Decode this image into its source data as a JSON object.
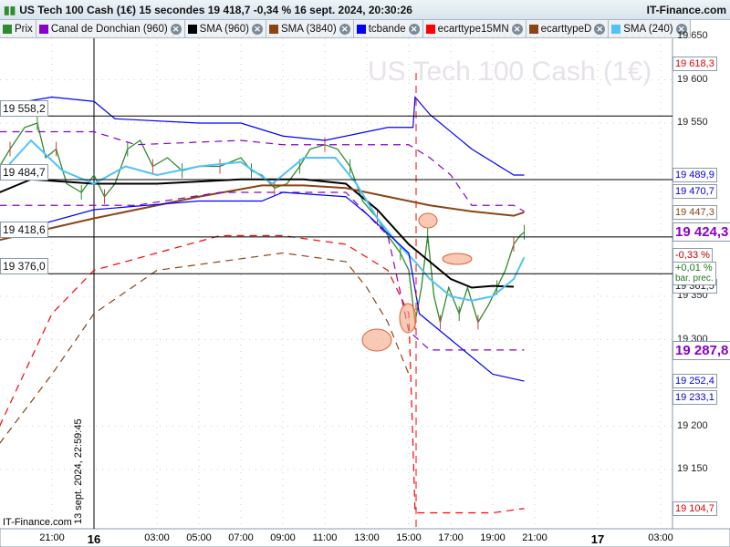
{
  "header": {
    "title": "US Tech 100 Cash (1€) 15 secondes 19 418,7 -0,34 % 16 sept. 2024, 20:30:26",
    "site": "IT-Finance.com"
  },
  "legend": [
    {
      "label": "Prix",
      "color": "#2e8b2e"
    },
    {
      "label": "Canal de Donchian (960)",
      "color": "#8a00c8"
    },
    {
      "label": "SMA (960)",
      "color": "#000000"
    },
    {
      "label": "SMA (3840)",
      "color": "#8b4513"
    },
    {
      "label": "tcbande",
      "color": "#0000ff"
    },
    {
      "label": "ecarttype15MN",
      "color": "#ff0000"
    },
    {
      "label": "ecarttypeD",
      "color": "#8b4513"
    },
    {
      "label": "SMA (240)",
      "color": "#4fc3f7"
    }
  ],
  "watermark": "US Tech 100 Cash (1€)",
  "footer": "IT-Finance.com",
  "vertical_date": "13 sept. 2024, 22:59:45",
  "chart_data": {
    "type": "line",
    "title": "US Tech 100 Cash (1€)",
    "ylim": [
      19090,
      19660
    ],
    "y_ticks": [
      "19 650",
      "19 600",
      "19 550",
      "19 350",
      "19 300",
      "19 200",
      "19 150"
    ],
    "y_tick_values": [
      19650,
      19600,
      19550,
      19350,
      19300,
      19200,
      19150
    ],
    "x_ticks": [
      {
        "label": "21:00",
        "h": -2
      },
      {
        "label": "16",
        "h": 0,
        "bold": true
      },
      {
        "label": "03:00",
        "h": 3
      },
      {
        "label": "05:00",
        "h": 5
      },
      {
        "label": "07:00",
        "h": 7
      },
      {
        "label": "09:00",
        "h": 9
      },
      {
        "label": "11:00",
        "h": 11
      },
      {
        "label": "13:00",
        "h": 13
      },
      {
        "label": "15:00",
        "h": 15
      },
      {
        "label": "17:00",
        "h": 17
      },
      {
        "label": "19:00",
        "h": 19
      },
      {
        "label": "21:00",
        "h": 21
      },
      {
        "label": "17",
        "h": 24,
        "bold": true
      },
      {
        "label": "03:00",
        "h": 27
      }
    ],
    "hlines": [
      {
        "label": "19 558,2",
        "value": 19558.2
      },
      {
        "label": "19 484,7",
        "value": 19484.7
      },
      {
        "label": "19 418,6",
        "value": 19418.6
      },
      {
        "label": "19 376,0",
        "value": 19376.0
      }
    ],
    "right_labels": [
      {
        "label": "19 618,3",
        "value": 19618.3,
        "color": "#e00000"
      },
      {
        "label": "19 489,9",
        "value": 19489.9,
        "color": "#0000e0"
      },
      {
        "label": "19 470,7",
        "value": 19470.7,
        "color": "#0000e0"
      },
      {
        "label": "19 447,3",
        "value": 19447.3,
        "color": "#8b4513"
      },
      {
        "label": "19 424,3",
        "value": 19424.3,
        "color": "#8a00c8",
        "big": true
      },
      {
        "label": "19 361,5",
        "value": 19361.5,
        "color": "#222222"
      },
      {
        "label": "19 287,8",
        "value": 19287.8,
        "color": "#8a00c8",
        "big": true
      },
      {
        "label": "19 252,4",
        "value": 19252.4,
        "color": "#0000e0"
      },
      {
        "label": "19 233,1",
        "value": 19233.1,
        "color": "#0000e0"
      },
      {
        "label": "19 104,7",
        "value": 19104.7,
        "color": "#e00000"
      }
    ],
    "change_label": "-0,33 %",
    "bar_change": "+0,01 %",
    "bar_change_caption": "bar. prec.",
    "series": [
      {
        "name": "Prix",
        "color": "#2e8b2e",
        "points": [
          [
            -4.5,
            19500
          ],
          [
            -4,
            19520
          ],
          [
            -3.3,
            19545
          ],
          [
            -2.7,
            19550
          ],
          [
            -2.3,
            19510
          ],
          [
            -1.8,
            19520
          ],
          [
            -1.3,
            19480
          ],
          [
            -0.6,
            19470
          ],
          [
            0,
            19490
          ],
          [
            0.5,
            19465
          ],
          [
            1,
            19480
          ],
          [
            1.6,
            19520
          ],
          [
            2.2,
            19530
          ],
          [
            2.8,
            19500
          ],
          [
            3.5,
            19510
          ],
          [
            4.2,
            19495
          ],
          [
            5,
            19500
          ],
          [
            6,
            19500
          ],
          [
            7,
            19510
          ],
          [
            7.5,
            19495
          ],
          [
            8,
            19490
          ],
          [
            8.6,
            19475
          ],
          [
            9.2,
            19480
          ],
          [
            9.8,
            19500
          ],
          [
            10.3,
            19520
          ],
          [
            11,
            19525
          ],
          [
            11.6,
            19520
          ],
          [
            12.2,
            19500
          ],
          [
            12.8,
            19460
          ],
          [
            13.5,
            19440
          ],
          [
            14,
            19420
          ],
          [
            14.6,
            19400
          ],
          [
            15,
            19380
          ],
          [
            15.3,
            19320
          ],
          [
            15.6,
            19360
          ],
          [
            15.9,
            19420
          ],
          [
            16.2,
            19350
          ],
          [
            16.5,
            19320
          ],
          [
            16.9,
            19360
          ],
          [
            17.4,
            19330
          ],
          [
            17.8,
            19360
          ],
          [
            18.3,
            19320
          ],
          [
            18.8,
            19340
          ],
          [
            19.2,
            19360
          ],
          [
            19.6,
            19380
          ],
          [
            20,
            19410
          ],
          [
            20.3,
            19420
          ],
          [
            20.5,
            19424
          ]
        ]
      },
      {
        "name": "SMA (960)",
        "color": "#000000",
        "points": [
          [
            -4.5,
            19470
          ],
          [
            -3,
            19485
          ],
          [
            0,
            19480
          ],
          [
            3,
            19480
          ],
          [
            7,
            19485
          ],
          [
            10,
            19485
          ],
          [
            12,
            19480
          ],
          [
            13.5,
            19450
          ],
          [
            15,
            19410
          ],
          [
            16,
            19390
          ],
          [
            17,
            19370
          ],
          [
            18,
            19360
          ],
          [
            19,
            19362
          ],
          [
            20,
            19361
          ]
        ]
      },
      {
        "name": "SMA (3840)",
        "color": "#8b4513",
        "points": [
          [
            -4.5,
            19415
          ],
          [
            0,
            19440
          ],
          [
            5,
            19465
          ],
          [
            8,
            19478
          ],
          [
            10,
            19478
          ],
          [
            12,
            19475
          ],
          [
            14,
            19465
          ],
          [
            16,
            19455
          ],
          [
            18,
            19448
          ],
          [
            20,
            19443
          ],
          [
            20.5,
            19447
          ]
        ]
      },
      {
        "name": "SMA (240)",
        "color": "#4fc3f7",
        "points": [
          [
            -4.5,
            19490
          ],
          [
            -3,
            19530
          ],
          [
            -1.5,
            19495
          ],
          [
            0,
            19480
          ],
          [
            1.5,
            19500
          ],
          [
            3,
            19490
          ],
          [
            5,
            19500
          ],
          [
            7,
            19505
          ],
          [
            8.5,
            19480
          ],
          [
            10,
            19510
          ],
          [
            11.5,
            19510
          ],
          [
            12.5,
            19480
          ],
          [
            13.5,
            19440
          ],
          [
            14.5,
            19410
          ],
          [
            15.3,
            19390
          ],
          [
            16,
            19370
          ],
          [
            17,
            19350
          ],
          [
            18,
            19345
          ],
          [
            19,
            19350
          ],
          [
            20,
            19370
          ],
          [
            20.5,
            19395
          ]
        ]
      },
      {
        "name": "Donchian haut",
        "color": "#8a00c8",
        "dash": true,
        "points": [
          [
            -4.5,
            19540
          ],
          [
            0,
            19540
          ],
          [
            2,
            19525
          ],
          [
            7,
            19530
          ],
          [
            9,
            19525
          ],
          [
            14,
            19525
          ],
          [
            15,
            19525
          ],
          [
            16,
            19510
          ],
          [
            17,
            19490
          ],
          [
            18,
            19455
          ],
          [
            20,
            19455
          ],
          [
            20.5,
            19448
          ]
        ]
      },
      {
        "name": "Donchian bas",
        "color": "#8a00c8",
        "dash": true,
        "points": [
          [
            -4.5,
            19455
          ],
          [
            2,
            19455
          ],
          [
            6,
            19470
          ],
          [
            9,
            19470
          ],
          [
            12,
            19470
          ],
          [
            14,
            19420
          ],
          [
            15,
            19310
          ],
          [
            16,
            19288
          ],
          [
            20.5,
            19288
          ]
        ]
      },
      {
        "name": "tcbande haut",
        "color": "#0000ff",
        "points": [
          [
            -4.5,
            19570
          ],
          [
            -2,
            19580
          ],
          [
            0,
            19575
          ],
          [
            1,
            19555
          ],
          [
            5,
            19550
          ],
          [
            7,
            19550
          ],
          [
            9,
            19535
          ],
          [
            11,
            19530
          ],
          [
            13,
            19540
          ],
          [
            14,
            19545
          ],
          [
            15.2,
            19545
          ],
          [
            15.3,
            19580
          ],
          [
            16,
            19560
          ],
          [
            18,
            19520
          ],
          [
            20,
            19490
          ],
          [
            20.5,
            19490
          ]
        ]
      },
      {
        "name": "tcbande bas",
        "color": "#0000ff",
        "points": [
          [
            -4.5,
            19420
          ],
          [
            0,
            19450
          ],
          [
            5,
            19460
          ],
          [
            8,
            19460
          ],
          [
            9,
            19470
          ],
          [
            12,
            19465
          ],
          [
            13,
            19445
          ],
          [
            15,
            19400
          ],
          [
            15.5,
            19330
          ],
          [
            17,
            19300
          ],
          [
            19,
            19260
          ],
          [
            20.5,
            19252
          ]
        ]
      },
      {
        "name": "ecarttype15MN",
        "color": "#ff0000",
        "dash": true,
        "points": [
          [
            -4.5,
            19200
          ],
          [
            -2,
            19330
          ],
          [
            0,
            19380
          ],
          [
            3,
            19400
          ],
          [
            6,
            19420
          ],
          [
            9,
            19420
          ],
          [
            12,
            19410
          ],
          [
            14,
            19380
          ],
          [
            15,
            19330
          ],
          [
            15.3,
            19100
          ],
          [
            17,
            19100
          ],
          [
            19,
            19100
          ],
          [
            20.5,
            19105
          ]
        ]
      },
      {
        "name": "ecarttypeD",
        "color": "#8b4513",
        "dash": true,
        "points": [
          [
            -4.5,
            19180
          ],
          [
            -2,
            19260
          ],
          [
            0,
            19330
          ],
          [
            3,
            19380
          ],
          [
            6,
            19390
          ],
          [
            9,
            19400
          ],
          [
            12,
            19390
          ],
          [
            13,
            19360
          ],
          [
            14,
            19320
          ],
          [
            15,
            19260
          ]
        ]
      }
    ]
  }
}
